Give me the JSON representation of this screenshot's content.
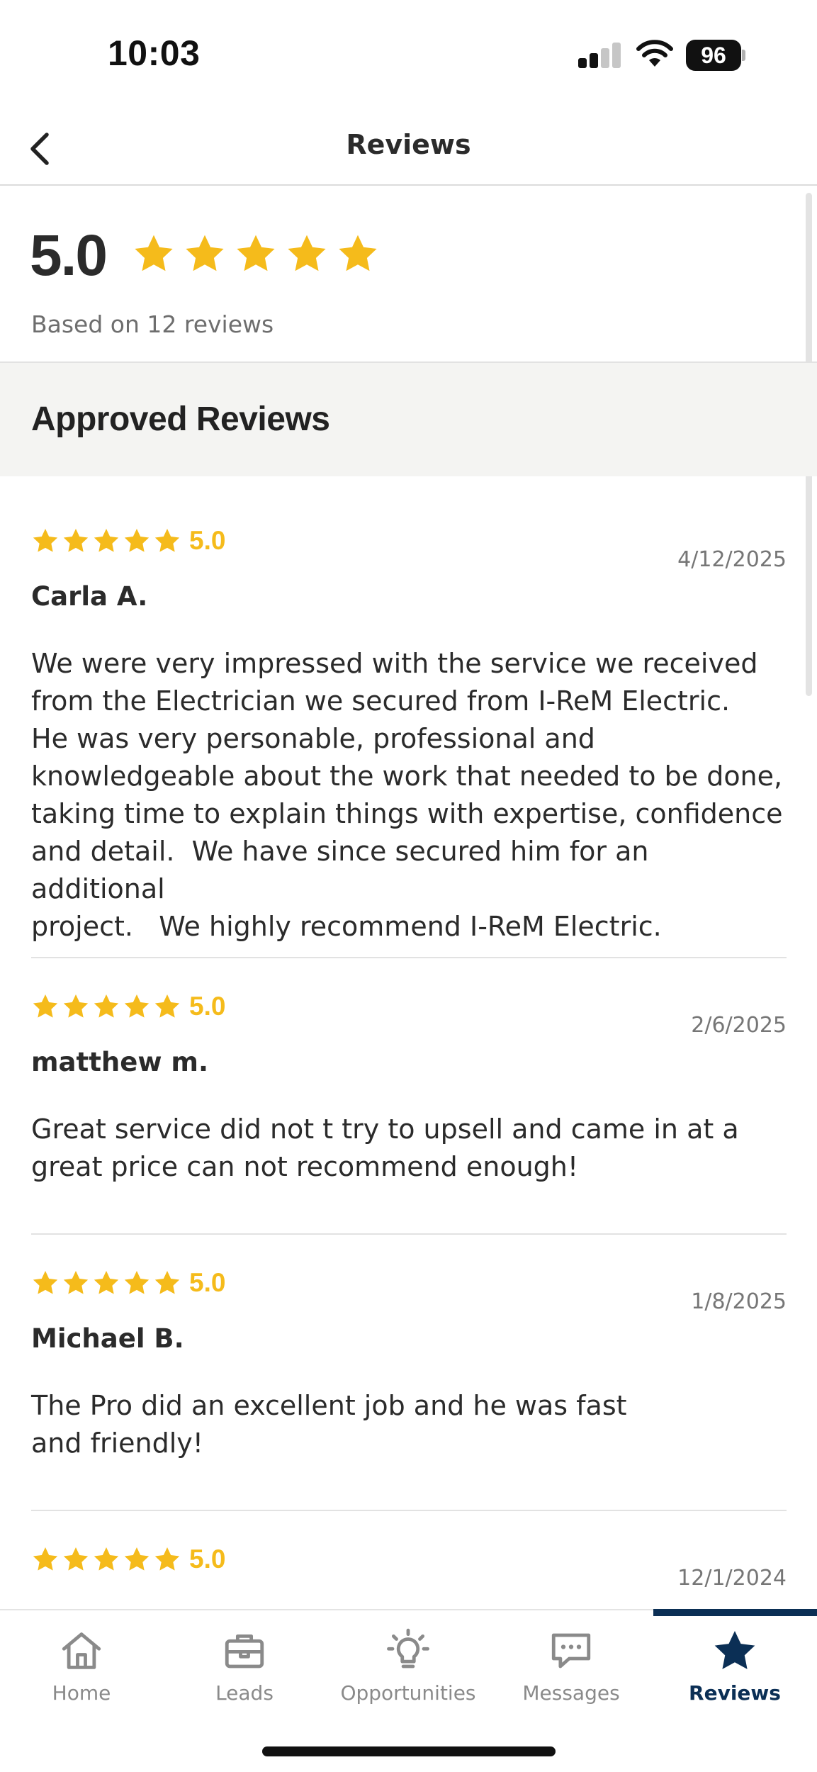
{
  "status_bar": {
    "time": "10:03",
    "battery": "96"
  },
  "header": {
    "title": "Reviews",
    "back_icon": "chevron-left-icon"
  },
  "summary": {
    "rating": "5.0",
    "stars": 5,
    "count_text": "Based on 12 reviews"
  },
  "section": {
    "title": "Approved Reviews"
  },
  "colors": {
    "star": "#f5bb1b",
    "active_tab": "#0b2f55",
    "inactive_tab": "#8a8a8a"
  },
  "reviews": [
    {
      "rating": "5.0",
      "stars": 5,
      "date": "4/12/2025",
      "author": "Carla A.",
      "text": "We were very impressed with the service we received\nfrom the Electrician we secured from I-ReM Electric.\nHe was very personable, professional and\nknowledgeable about the work that needed to be done,\ntaking time to explain things with expertise, confidence\nand detail.  We have since secured him for an additional\nproject.   We highly recommend I-ReM Electric."
    },
    {
      "rating": "5.0",
      "stars": 5,
      "date": "2/6/2025",
      "author": "matthew m.",
      "text": "Great service did not t try to upsell and came in at a\ngreat price can not recommend enough!"
    },
    {
      "rating": "5.0",
      "stars": 5,
      "date": "1/8/2025",
      "author": "Michael B.",
      "text": "The Pro did an excellent job and he was fast\nand friendly!"
    },
    {
      "rating": "5.0",
      "stars": 5,
      "date": "12/1/2024",
      "author": "",
      "text": ""
    }
  ],
  "tabs": [
    {
      "label": "Home",
      "icon": "home-icon"
    },
    {
      "label": "Leads",
      "icon": "briefcase-icon"
    },
    {
      "label": "Opportunities",
      "icon": "lightbulb-icon"
    },
    {
      "label": "Messages",
      "icon": "message-icon"
    },
    {
      "label": "Reviews",
      "icon": "star-icon",
      "active": true
    }
  ]
}
